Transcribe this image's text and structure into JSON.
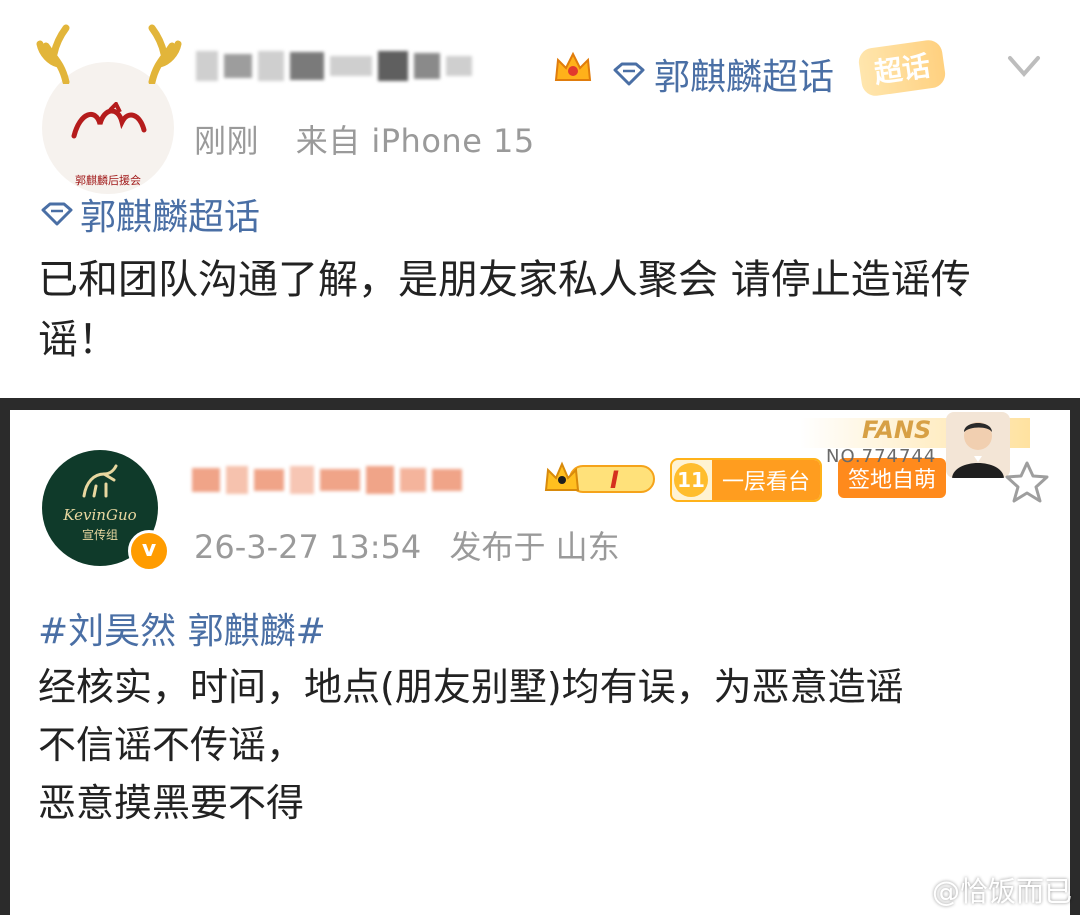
{
  "post1": {
    "avatar_caption": "郭麒麟后援会",
    "topic_header": "郭麒麟超话",
    "chaohua_tag": "超话",
    "time": "刚刚",
    "source": "来自 iPhone 15",
    "topic_line": "郭麒麟超话",
    "body": "已和团队沟通了解，是朋友家私人聚会 请停止造谣传谣！"
  },
  "post2": {
    "avatar_logo": "KevinGuo",
    "avatar_sub": "宣传组",
    "verify_mark": "v",
    "level": "I",
    "floor_num": "11",
    "floor_label": "一层看台",
    "sign_label": "签地自萌",
    "fans_label": "FANS",
    "fans_no": "NO.774744",
    "datetime": "26-3-27 13:54",
    "location": "发布于 山东",
    "tags": "#刘昊然 郭麒麟#",
    "lines": [
      "经核实，时间，地点(朋友别墅)均有误，为恶意造谣",
      "不信谣不传谣，",
      "恶意摸黑要不得"
    ]
  },
  "watermark": "@恰饭而已",
  "colors": {
    "link": "#4a6fa5",
    "meta": "#9a9a9a",
    "accent_orange": "#ff9c00"
  }
}
